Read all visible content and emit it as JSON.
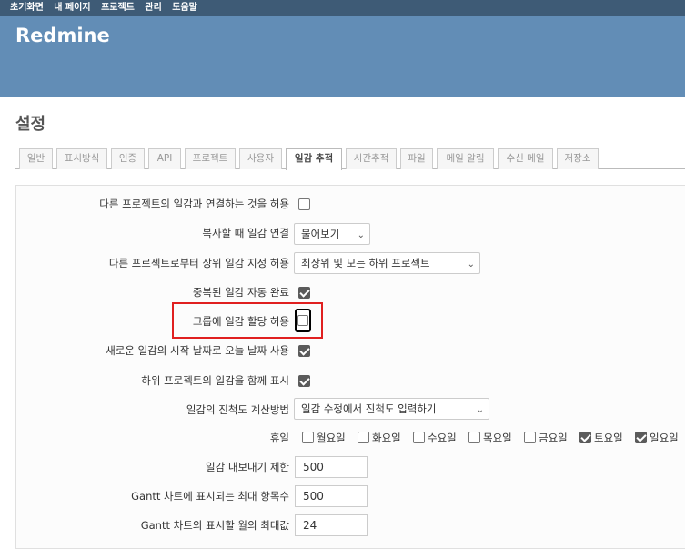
{
  "top_menu": {
    "items": [
      "초기화면",
      "내 페이지",
      "프로젝트",
      "관리",
      "도움말"
    ]
  },
  "header": {
    "title": "Redmine"
  },
  "page": {
    "title": "설정"
  },
  "tabs": [
    {
      "label": "일반"
    },
    {
      "label": "표시방식"
    },
    {
      "label": "인증"
    },
    {
      "label": "API"
    },
    {
      "label": "프로젝트"
    },
    {
      "label": "사용자"
    },
    {
      "label": "일감 추적"
    },
    {
      "label": "시간추적"
    },
    {
      "label": "파일"
    },
    {
      "label": "메일 알림"
    },
    {
      "label": "수신 메일"
    },
    {
      "label": "저장소"
    }
  ],
  "selected_tab": "일감 추적",
  "settings": {
    "cross_project_relations": {
      "label": "다른 프로젝트의 일감과 연결하는 것을 허용",
      "checked": false
    },
    "link_copied_issue": {
      "label": "복사할 때 일감 연결",
      "value": "물어보기"
    },
    "cross_project_subtasks": {
      "label": "다른 프로젝트로부터 상위 일감 지정 허용",
      "value": "최상위 및 모든 하위 프로젝트"
    },
    "close_duplicate_issues": {
      "label": "중복된 일감 자동 완료",
      "checked": true
    },
    "issue_group_assignment": {
      "label": "그룹에 일감 할당 허용",
      "checked": false
    },
    "default_issue_start_date": {
      "label": "새로운 일감의 시작 날짜로 오늘 날짜 사용",
      "checked": true
    },
    "display_subprojects_issues": {
      "label": "하위 프로젝트의 일감을 함께 표시",
      "checked": true
    },
    "done_ratio_calculation": {
      "label": "일감의 진척도 계산방법",
      "value": "일감 수정에서 진척도 입력하기"
    },
    "non_working_week_days": {
      "label": "휴일",
      "days": [
        {
          "label": "월요일",
          "checked": false
        },
        {
          "label": "화요일",
          "checked": false
        },
        {
          "label": "수요일",
          "checked": false
        },
        {
          "label": "목요일",
          "checked": false
        },
        {
          "label": "금요일",
          "checked": false
        },
        {
          "label": "토요일",
          "checked": true
        },
        {
          "label": "일요일",
          "checked": true
        }
      ]
    },
    "export_limit": {
      "label": "일감 내보내기 제한",
      "value": "500"
    },
    "gantt_items_limit": {
      "label": "Gantt 차트에 표시되는 최대 항목수",
      "value": "500"
    },
    "gantt_months_limit": {
      "label": "Gantt 차트의 표시할 월의 최대값",
      "value": "24"
    }
  },
  "colors": {
    "top_menu_bg": "#3e5b76",
    "header_bg": "#628db6",
    "highlight": "#e02020"
  }
}
